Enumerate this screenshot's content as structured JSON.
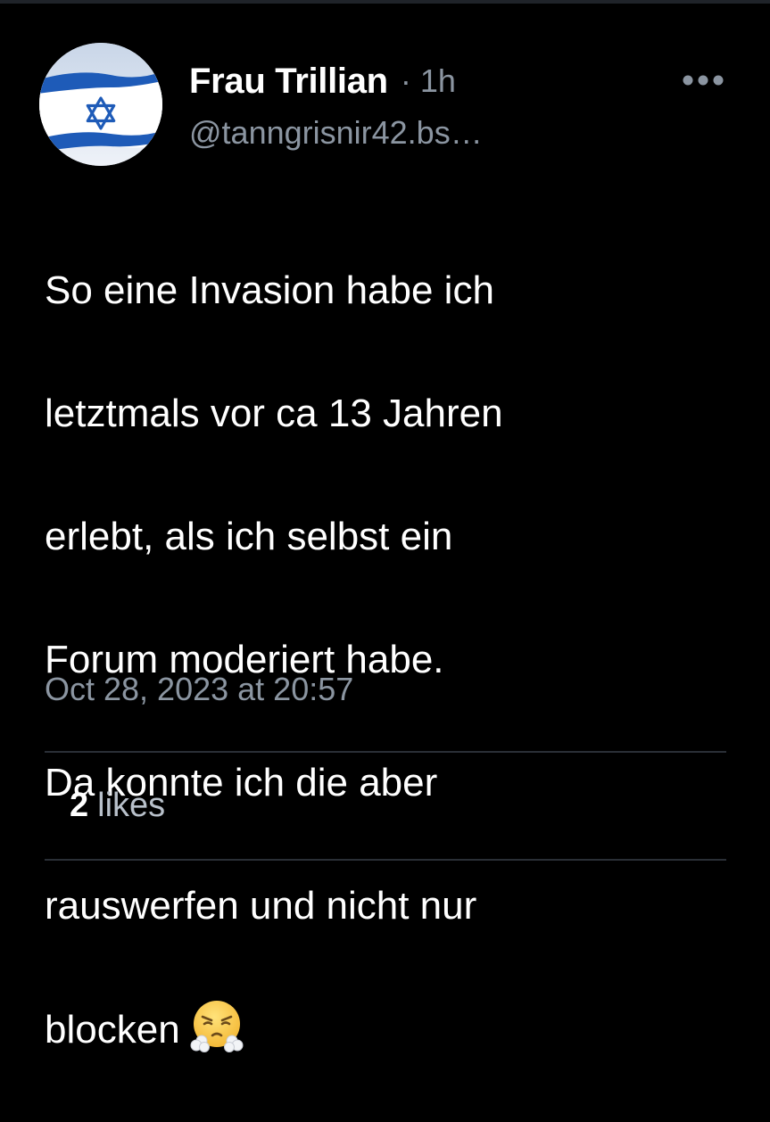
{
  "post": {
    "author": {
      "display_name": "Frau Trillian",
      "handle": "@tanngrisnir42.bs…",
      "avatar": "israel-flag-avatar"
    },
    "separator": "·",
    "relative_time": "1h",
    "more_icon": "ellipsis-icon",
    "text_lines": [
      "So eine Invasion habe ich",
      "letztmals vor ca 13 Jahren",
      "erlebt, als ich selbst ein",
      "Forum moderiert habe.",
      "Da konnte ich die aber",
      "rauswerfen und nicht nur",
      "blocken"
    ],
    "emoji": "face-with-steam-from-nose",
    "date": "Oct 28, 2023 at 20:57",
    "likes": {
      "count": "2",
      "label": "likes"
    }
  },
  "colors": {
    "background": "#000000",
    "text": "#ffffff",
    "muted": "#8b95a1",
    "divider": "#2a2f36",
    "flag_blue": "#1e5bb8"
  }
}
